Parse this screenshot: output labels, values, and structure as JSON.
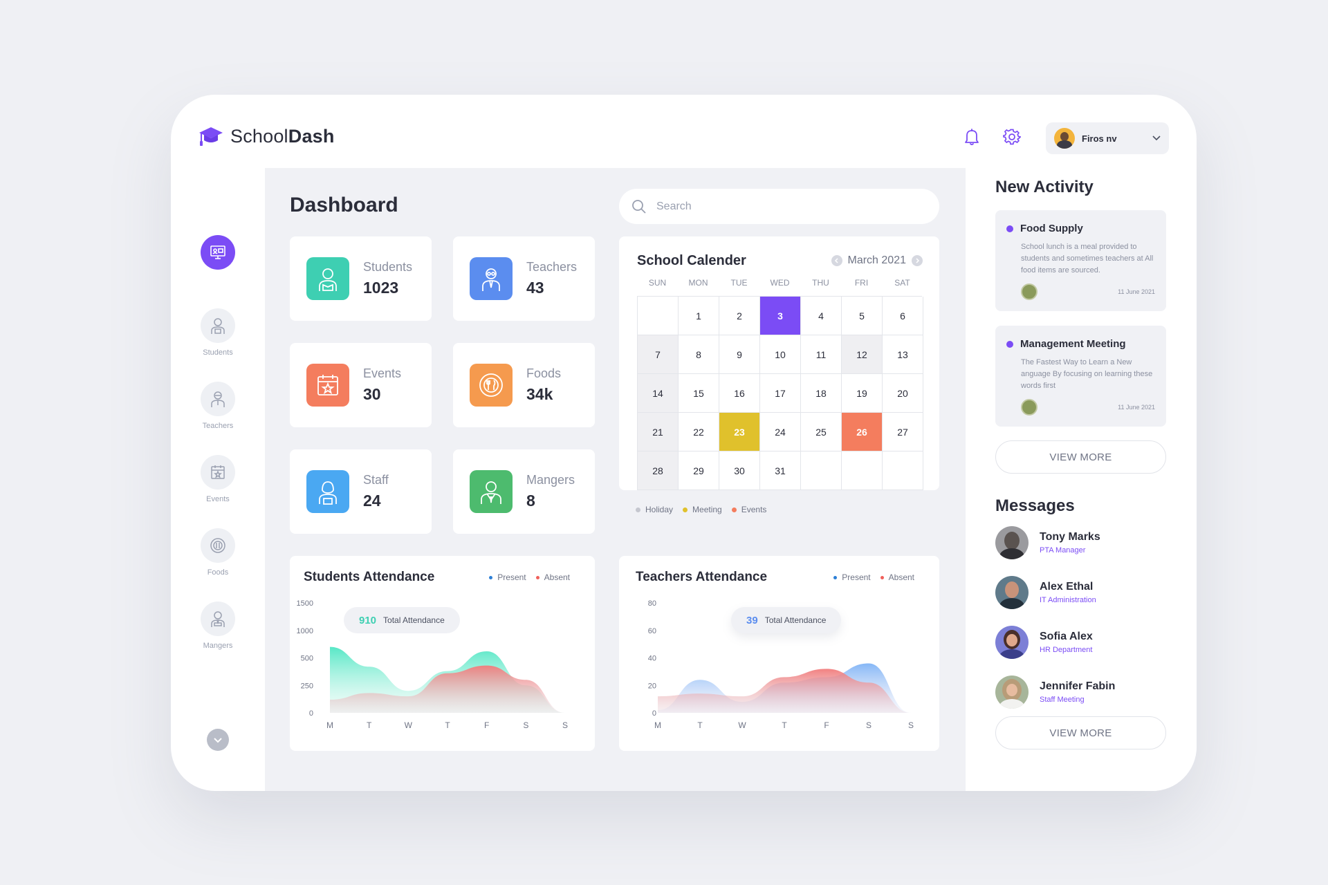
{
  "app": {
    "logo_regular": "School",
    "logo_bold": "Dash"
  },
  "header": {
    "user_name": "Firos nv"
  },
  "sidebar": {
    "items": [
      {
        "label": "Students",
        "icon": "student-icon"
      },
      {
        "label": "Teachers",
        "icon": "teacher-icon"
      },
      {
        "label": "Events",
        "icon": "calendar-icon"
      },
      {
        "label": "Foods",
        "icon": "food-icon"
      },
      {
        "label": "Mangers",
        "icon": "manager-icon"
      }
    ]
  },
  "main": {
    "title": "Dashboard",
    "search_placeholder": "Search",
    "stats": [
      {
        "label": "Students",
        "value": "1023",
        "color": "#3ecfb2"
      },
      {
        "label": "Teachers",
        "value": "43",
        "color": "#5b8def"
      },
      {
        "label": "Events",
        "value": "30",
        "color": "#f47d5e"
      },
      {
        "label": "Foods",
        "value": "34k",
        "color": "#f59a4e"
      },
      {
        "label": "Staff",
        "value": "24",
        "color": "#4aa8f2"
      },
      {
        "label": "Mangers",
        "value": "8",
        "color": "#4dbb6e"
      }
    ]
  },
  "calendar": {
    "title": "School Calender",
    "month": "March 2021",
    "weekdays": [
      "SUN",
      "MON",
      "TUE",
      "WED",
      "THU",
      "FRI",
      "SAT"
    ],
    "weeks": [
      [
        "",
        "1",
        "2",
        "3",
        "4",
        "5",
        "6"
      ],
      [
        "7",
        "8",
        "9",
        "10",
        "11",
        "12",
        "13"
      ],
      [
        "14",
        "15",
        "16",
        "17",
        "18",
        "19",
        "20"
      ],
      [
        "21",
        "22",
        "23",
        "24",
        "25",
        "26",
        "27"
      ],
      [
        "28",
        "29",
        "30",
        "31",
        "",
        "",
        ""
      ]
    ],
    "highlight": {
      "today": "3",
      "meeting": "23",
      "event": "26"
    },
    "legend": [
      {
        "label": "Holiday",
        "color": "#c5c7cf"
      },
      {
        "label": "Meeting",
        "color": "#e0c12c"
      },
      {
        "label": "Events",
        "color": "#f47d5e"
      }
    ]
  },
  "students_attendance": {
    "title": "Students Attendance",
    "total_value": "910",
    "total_label": "Total Attendance",
    "legend": [
      {
        "label": "Present",
        "color": "#2c7fd6"
      },
      {
        "label": "Absent",
        "color": "#f0605a"
      }
    ],
    "chart_data": {
      "type": "area",
      "x": [
        "M",
        "T",
        "W",
        "T",
        "F",
        "S",
        "S"
      ],
      "y_ticks": [
        "1500",
        "1000",
        "500",
        "250",
        "0"
      ],
      "series": [
        {
          "name": "Present",
          "values": [
            600,
            420,
            200,
            380,
            560,
            250,
            0
          ]
        },
        {
          "name": "Absent",
          "values": [
            120,
            180,
            150,
            360,
            430,
            300,
            0
          ]
        }
      ]
    }
  },
  "teachers_attendance": {
    "title": "Teachers Attendance",
    "total_value": "39",
    "total_label": "Total Attendance",
    "legend": [
      {
        "label": "Present",
        "color": "#2c7fd6"
      },
      {
        "label": "Absent",
        "color": "#f0605a"
      }
    ],
    "chart_data": {
      "type": "area",
      "x": [
        "M",
        "T",
        "W",
        "T",
        "F",
        "S",
        "S"
      ],
      "y_ticks": [
        "80",
        "60",
        "40",
        "20",
        "0"
      ],
      "series": [
        {
          "name": "Present",
          "values": [
            2,
            24,
            8,
            22,
            26,
            36,
            0
          ]
        },
        {
          "name": "Absent",
          "values": [
            12,
            14,
            12,
            26,
            32,
            22,
            0
          ]
        }
      ]
    }
  },
  "activity": {
    "title": "New Activity",
    "items": [
      {
        "title": "Food Supply",
        "desc": "School lunch is a meal provided to students and sometimes teachers at All food items are sourced.",
        "date": "11 June 2021"
      },
      {
        "title": "Management Meeting",
        "desc": "The Fastest Way to Learn a New anguage By focusing on learning these words first",
        "date": "11 June 2021"
      }
    ],
    "view_more": "VIEW MORE"
  },
  "messages": {
    "title": "Messages",
    "items": [
      {
        "name": "Tony Marks",
        "role": "PTA Manager"
      },
      {
        "name": "Alex Ethal",
        "role": "IT Administration"
      },
      {
        "name": "Sofia Alex",
        "role": "HR Department"
      },
      {
        "name": "Jennifer Fabin",
        "role": "Staff Meeting"
      }
    ],
    "view_more": "VIEW MORE"
  },
  "colors": {
    "accent": "#7b4cf5",
    "background": "#eff0f4"
  }
}
